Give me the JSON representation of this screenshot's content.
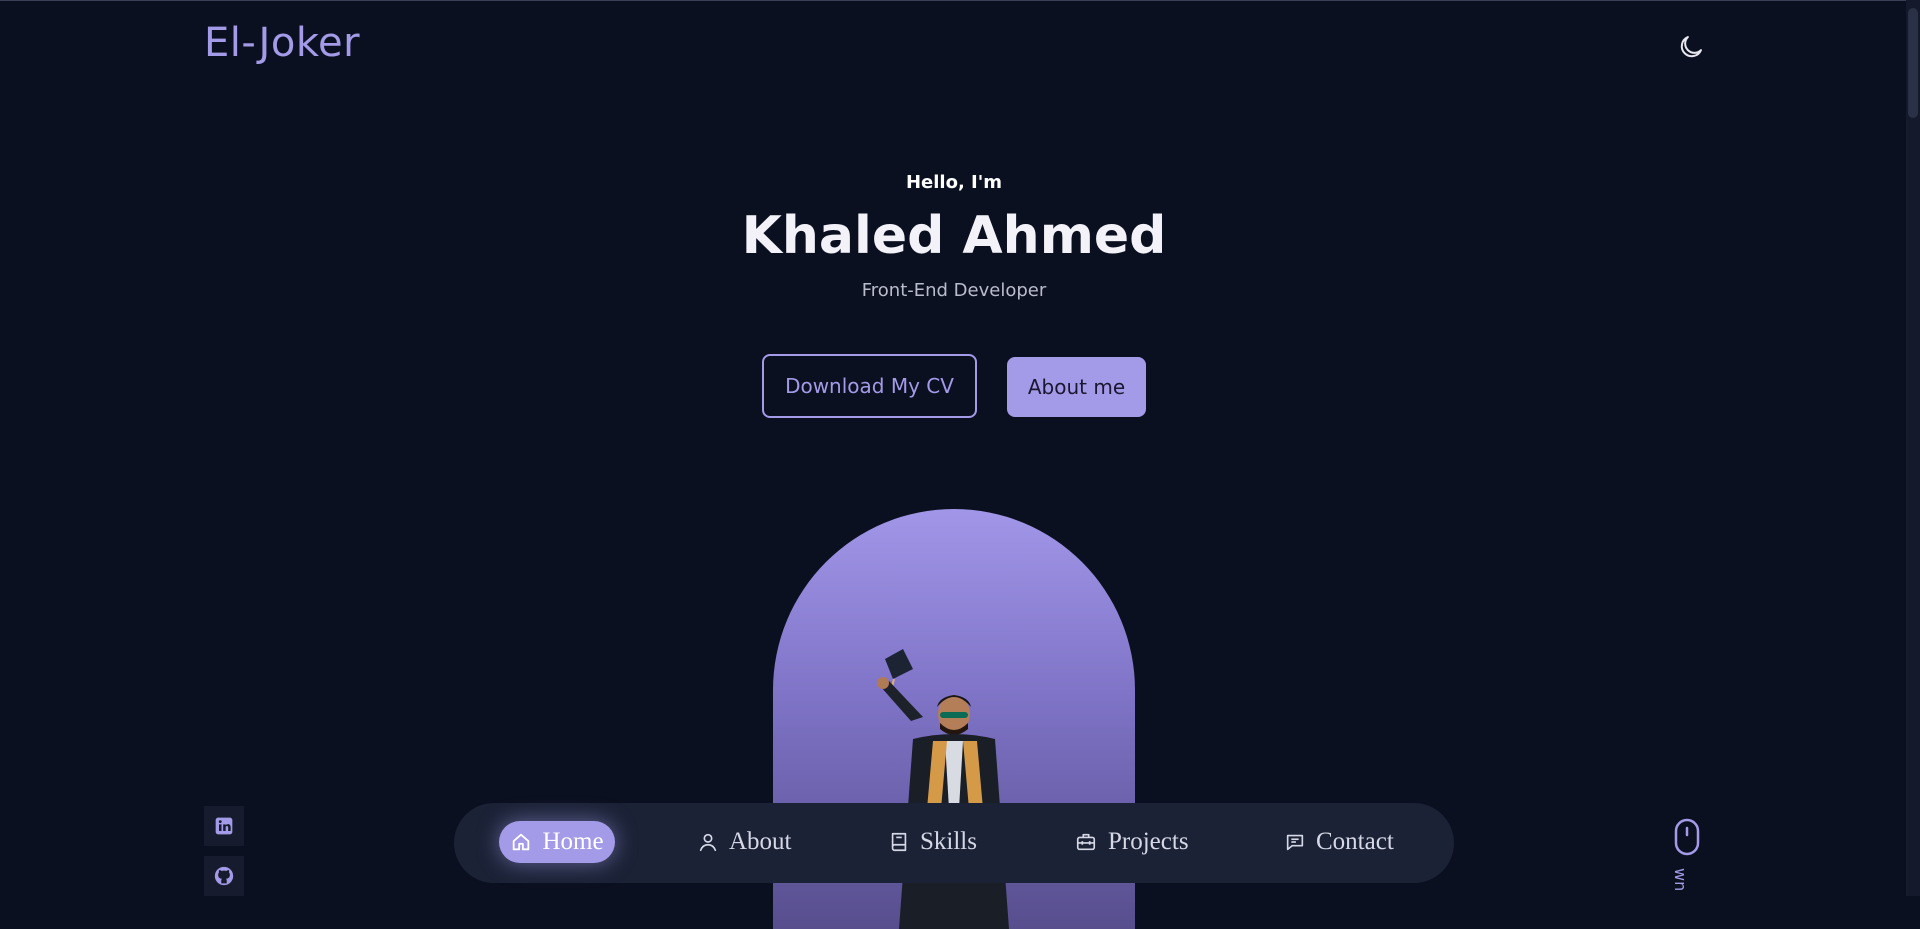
{
  "header": {
    "logo": "El-Joker",
    "theme_toggle_icon": "moon-icon"
  },
  "hero": {
    "greeting": "Hello, I'm",
    "name": "Khaled Ahmed",
    "role": "Front-End Developer",
    "cv_button": "Download My CV",
    "about_button": "About me",
    "photo": "graduate-portrait"
  },
  "social": [
    {
      "name": "linkedin",
      "icon": "linkedin-icon"
    },
    {
      "name": "github",
      "icon": "github-icon"
    }
  ],
  "nav": {
    "items": [
      {
        "label": "Home",
        "icon": "home-icon",
        "active": true
      },
      {
        "label": "About",
        "icon": "user-icon",
        "active": false
      },
      {
        "label": "Skills",
        "icon": "book-icon",
        "active": false
      },
      {
        "label": "Projects",
        "icon": "briefcase-icon",
        "active": false
      },
      {
        "label": "Contact",
        "icon": "message-icon",
        "active": false
      }
    ]
  },
  "scroll_hint": {
    "icon": "mouse-icon",
    "label": "wn"
  },
  "colors": {
    "background": "#0b1020",
    "accent": "#a39ae8",
    "nav_bg": "#1b2236"
  }
}
